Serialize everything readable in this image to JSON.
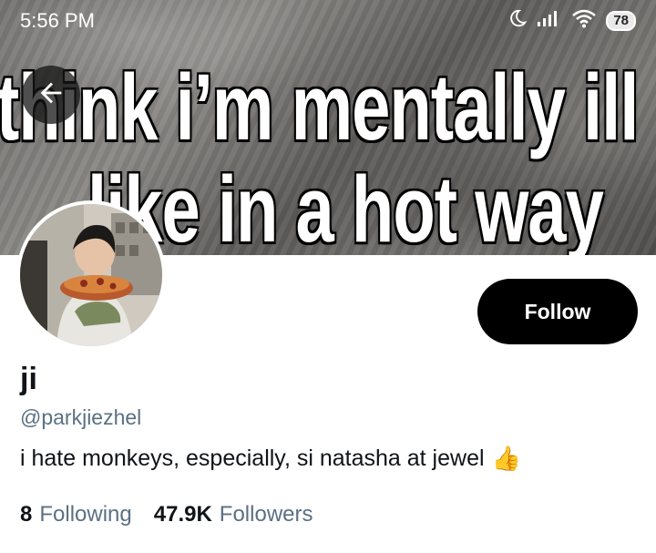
{
  "status_bar": {
    "time": "5:56 PM",
    "icons": [
      "moon-icon",
      "signal-icon",
      "wifi-icon",
      "battery-icon"
    ],
    "battery_level": "78"
  },
  "banner": {
    "line1": "think i’m mentally ill bu",
    "line2": "like in a hot way"
  },
  "header": {
    "back_icon": "arrow-left-icon"
  },
  "profile": {
    "follow_label": "Follow",
    "display_name": "ji",
    "handle": "@parkjiezhel",
    "bio": "i hate monkeys, especially, si natasha at jewel",
    "bio_emoji": "👍",
    "following_count": "8",
    "following_label": "Following",
    "followers_count": "47.9K",
    "followers_label": "Followers"
  },
  "colors": {
    "primary_text": "#0f1419",
    "secondary_text": "#5b7083",
    "follow_button_bg": "#000000"
  }
}
